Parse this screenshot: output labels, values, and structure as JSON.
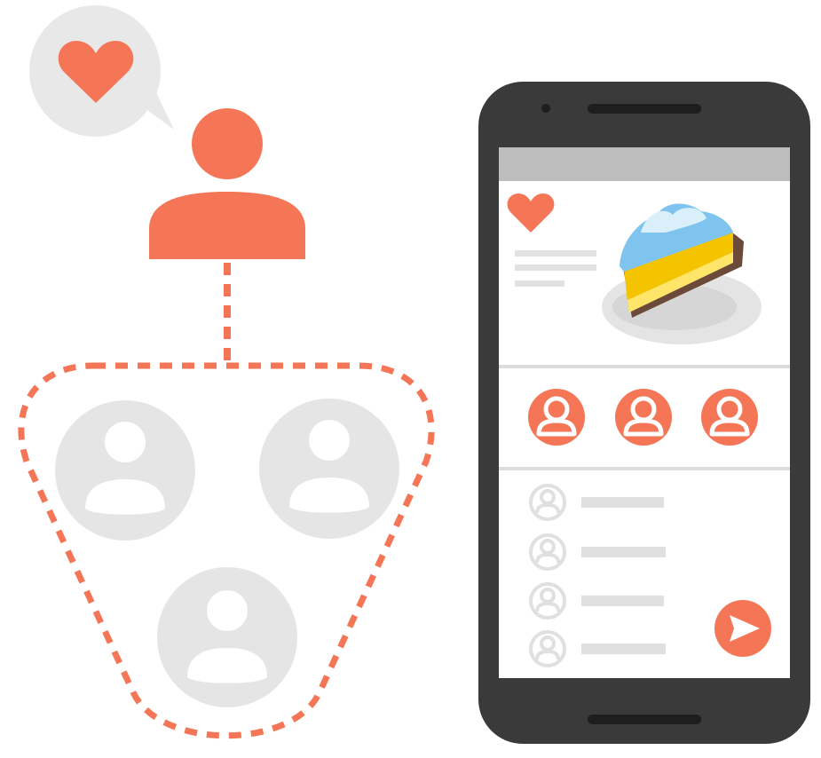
{
  "colors": {
    "accent": "#F47656",
    "gray_light": "#E5E5E5",
    "gray_icon": "#E0E0E0",
    "phone_body": "#3A3A3A",
    "status_bar": "#BDBDBD",
    "divider": "#D6D6D6",
    "white": "#FFFFFF"
  },
  "icons": {
    "speech_bubble": "heart-speech-bubble-icon",
    "user": "user-icon",
    "group_member": "person-circle-icon",
    "heart": "heart-icon",
    "cake": "cake-slice-icon",
    "send": "send-icon"
  },
  "phone": {
    "profile_count": 3,
    "list_row_count": 4
  }
}
